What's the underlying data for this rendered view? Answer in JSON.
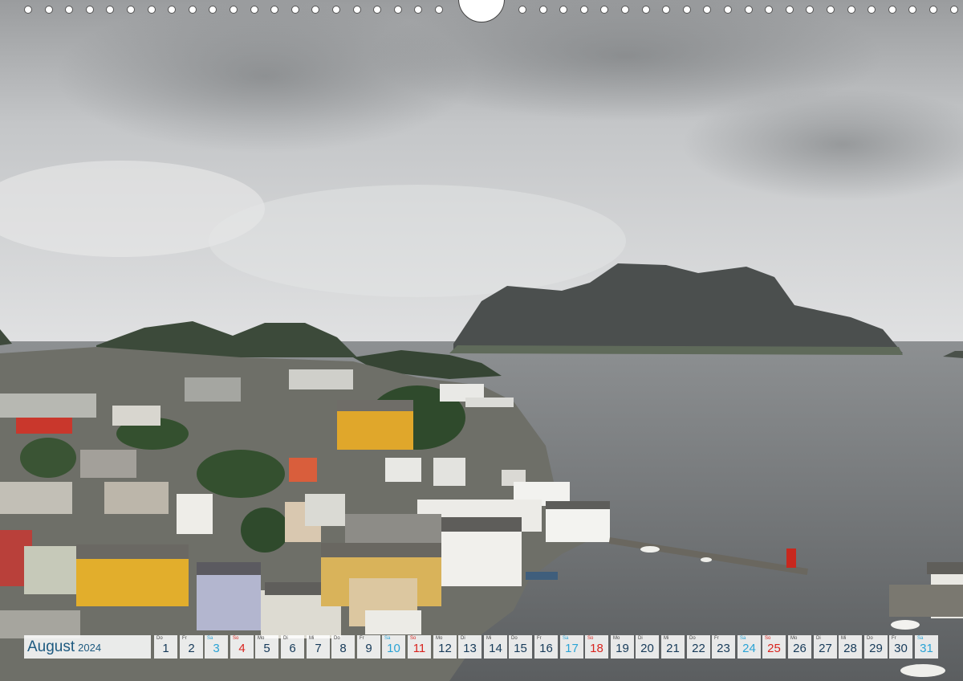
{
  "calendar": {
    "month": "August",
    "year": "2024",
    "colors": {
      "weekday": "#163a59",
      "saturday": "#2aa3d5",
      "sunday": "#d9241f",
      "month": "#1d5a80"
    },
    "days": [
      {
        "wd": "Do",
        "num": "1",
        "type": "weekday"
      },
      {
        "wd": "Fr",
        "num": "2",
        "type": "weekday"
      },
      {
        "wd": "Sa",
        "num": "3",
        "type": "sat"
      },
      {
        "wd": "So",
        "num": "4",
        "type": "sun"
      },
      {
        "wd": "Mo",
        "num": "5",
        "type": "weekday"
      },
      {
        "wd": "Di",
        "num": "6",
        "type": "weekday"
      },
      {
        "wd": "Mi",
        "num": "7",
        "type": "weekday"
      },
      {
        "wd": "Do",
        "num": "8",
        "type": "weekday"
      },
      {
        "wd": "Fr",
        "num": "9",
        "type": "weekday"
      },
      {
        "wd": "Sa",
        "num": "10",
        "type": "sat"
      },
      {
        "wd": "So",
        "num": "11",
        "type": "sun"
      },
      {
        "wd": "Mo",
        "num": "12",
        "type": "weekday"
      },
      {
        "wd": "Di",
        "num": "13",
        "type": "weekday"
      },
      {
        "wd": "Mi",
        "num": "14",
        "type": "weekday"
      },
      {
        "wd": "Do",
        "num": "15",
        "type": "weekday"
      },
      {
        "wd": "Fr",
        "num": "16",
        "type": "weekday"
      },
      {
        "wd": "Sa",
        "num": "17",
        "type": "sat"
      },
      {
        "wd": "So",
        "num": "18",
        "type": "sun"
      },
      {
        "wd": "Mo",
        "num": "19",
        "type": "weekday"
      },
      {
        "wd": "Di",
        "num": "20",
        "type": "weekday"
      },
      {
        "wd": "Mi",
        "num": "21",
        "type": "weekday"
      },
      {
        "wd": "Do",
        "num": "22",
        "type": "weekday"
      },
      {
        "wd": "Fr",
        "num": "23",
        "type": "weekday"
      },
      {
        "wd": "Sa",
        "num": "24",
        "type": "sat"
      },
      {
        "wd": "So",
        "num": "25",
        "type": "sun"
      },
      {
        "wd": "Mo",
        "num": "26",
        "type": "weekday"
      },
      {
        "wd": "Di",
        "num": "27",
        "type": "weekday"
      },
      {
        "wd": "Mi",
        "num": "28",
        "type": "weekday"
      },
      {
        "wd": "Do",
        "num": "29",
        "type": "weekday"
      },
      {
        "wd": "Fr",
        "num": "30",
        "type": "weekday"
      },
      {
        "wd": "Sa",
        "num": "31",
        "type": "sat"
      }
    ]
  },
  "photo": {
    "colors": {
      "sky": "#d9dadb",
      "sea": "#6d7072",
      "mountain": "#4a4e4d",
      "hill": "#3e4a3c"
    }
  }
}
